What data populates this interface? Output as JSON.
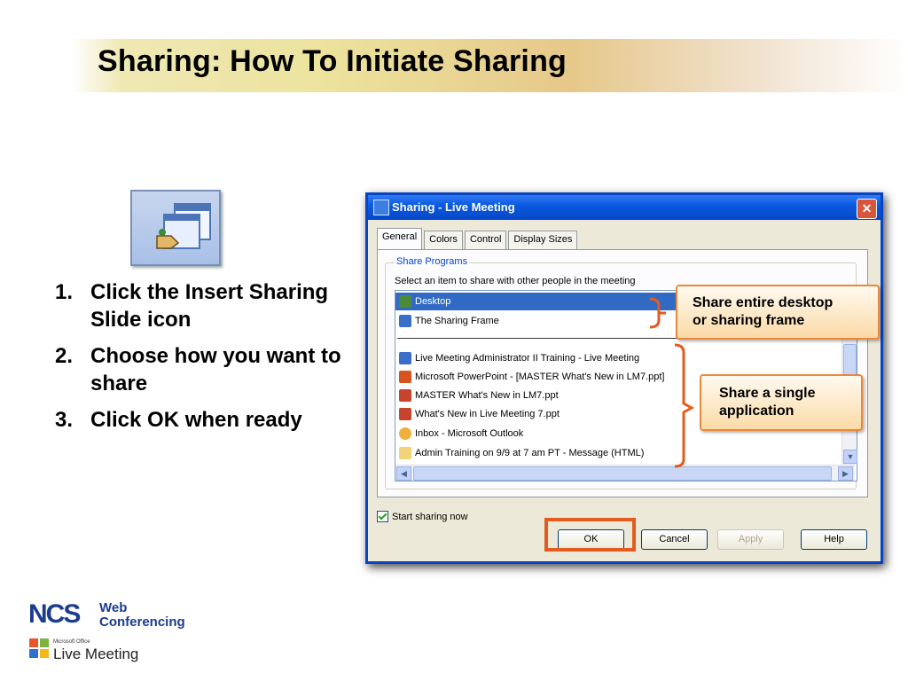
{
  "slide": {
    "title": "Sharing: How To Initiate Sharing",
    "steps": [
      {
        "num": "1.",
        "text": "Click the Insert Sharing Slide icon"
      },
      {
        "num": "2.",
        "text": "Choose how you want to share"
      },
      {
        "num": "3.",
        "text": "Click OK when ready"
      }
    ],
    "callouts": {
      "desktop": [
        "Share entire desktop",
        "or sharing frame"
      ],
      "application": [
        "Share a single",
        "application"
      ]
    }
  },
  "dialog": {
    "title": "Sharing - Live Meeting",
    "close": "✕",
    "tabs": [
      "General",
      "Colors",
      "Control",
      "Display Sizes"
    ],
    "active_tab": "General",
    "group_label": "Share Programs",
    "instruction": "Select an item to share with other people in the meeting",
    "items": [
      {
        "label": "Desktop",
        "icon": "desktop-icon",
        "selected": true
      },
      {
        "label": "The Sharing Frame",
        "icon": "sharing-frame-icon",
        "selected": false
      },
      {
        "label": "Live Meeting Administrator II Training - Live Meeting",
        "icon": "live-meeting-icon",
        "selected": false
      },
      {
        "label": "Microsoft PowerPoint - [MASTER What's New in LM7.ppt]",
        "icon": "powerpoint-icon",
        "selected": false
      },
      {
        "label": "MASTER What's New in LM7.ppt",
        "icon": "ppt-file-icon",
        "selected": false
      },
      {
        "label": "What's New in Live Meeting 7.ppt",
        "icon": "ppt-file-icon",
        "selected": false
      },
      {
        "label": "Inbox - Microsoft Outlook",
        "icon": "outlook-icon",
        "selected": false
      },
      {
        "label": "Admin Training on 9/9 at 7 am PT - Message (HTML)",
        "icon": "email-icon",
        "selected": false
      }
    ],
    "start_sharing_label": "Start sharing now",
    "start_sharing_checked": true,
    "buttons": {
      "ok": "OK",
      "cancel": "Cancel",
      "apply": "Apply",
      "help": "Help"
    }
  },
  "logos": {
    "ncs": "NCS",
    "web_line1": "Web",
    "web_line2": "Conferencing",
    "ms_office": "Microsoft Office",
    "live_meeting": "Live Meeting"
  },
  "colors": {
    "accent": "#e35b1e",
    "selection": "#316ac5",
    "titlebar": "#0b5ae0"
  }
}
